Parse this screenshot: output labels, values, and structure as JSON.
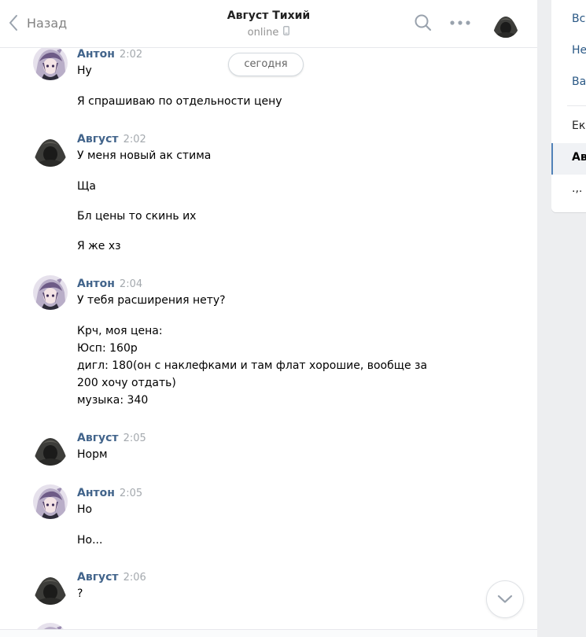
{
  "header": {
    "back_label": "Назад",
    "title": "Август Тихий",
    "status": "online"
  },
  "date_separator": "сегодня",
  "colors": {
    "author": "#42648b",
    "time": "#a4a9ae",
    "accent": "#5181b8"
  },
  "messages": [
    {
      "author": "Антон",
      "time": "2:02",
      "avatar": "anime-avatar",
      "lines": [
        "Ну",
        "Я спрашиваю по отдельности цену"
      ]
    },
    {
      "author": "Август",
      "time": "2:02",
      "avatar": "dark-hood-avatar",
      "lines": [
        "У меня новый ак стима",
        "Ща",
        "Бл цены то скинь их",
        "Я же хз"
      ]
    },
    {
      "author": "Антон",
      "time": "2:04",
      "avatar": "anime-avatar",
      "lines": [
        "У тебя расширения нету?",
        "Крч, моя цена:\nЮсп: 160р\nдигл: 180(он с наклефками и там флат хорошие, вообще за 200 хочу отдать)\nмузыка: 340"
      ]
    },
    {
      "author": "Август",
      "time": "2:05",
      "avatar": "dark-hood-avatar",
      "lines": [
        "Норм"
      ]
    },
    {
      "author": "Антон",
      "time": "2:05",
      "avatar": "anime-avatar",
      "lines": [
        "Но",
        "Но..."
      ]
    },
    {
      "author": "Август",
      "time": "2:06",
      "avatar": "dark-hood-avatar",
      "lines": [
        "?"
      ]
    }
  ],
  "sidebar": {
    "items": [
      {
        "label": "Вс"
      },
      {
        "label": "Не"
      },
      {
        "label": "Ва"
      },
      {
        "label": "Ек"
      },
      {
        "label": "Ав"
      },
      {
        "label": ".,."
      }
    ]
  },
  "icons": {
    "back": "chevron-left-icon",
    "phone": "mobile-phone-icon",
    "search": "search-icon",
    "more": "more-dots-icon",
    "scroll_down": "chevron-down-icon"
  }
}
